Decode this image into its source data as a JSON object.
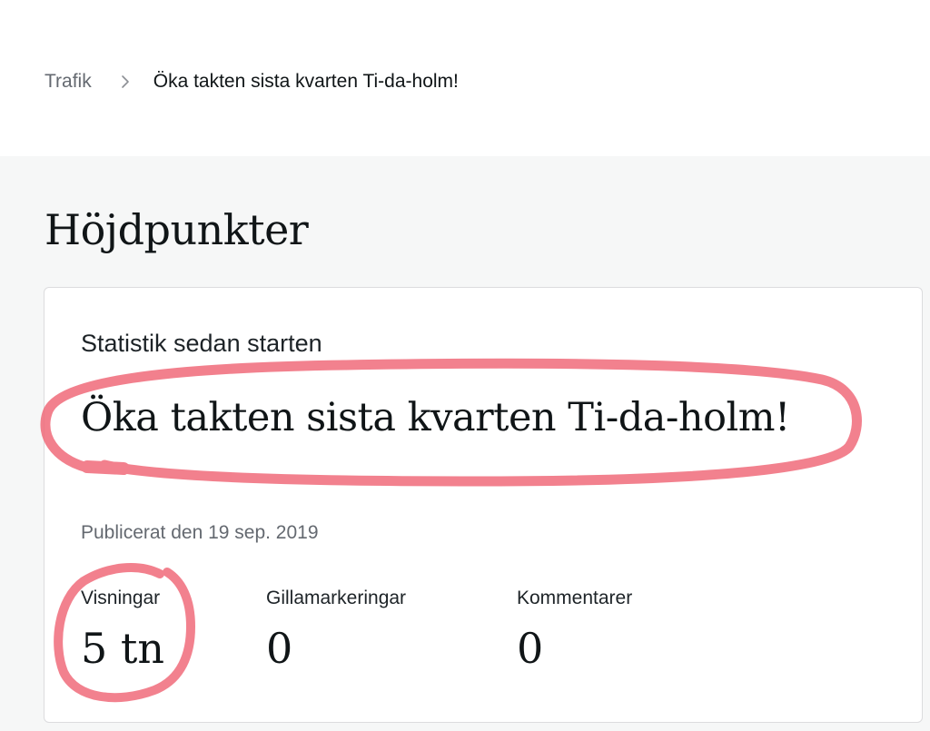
{
  "breadcrumb": {
    "parent": "Trafik",
    "current": "Öka takten sista kvarten Ti-da-holm!"
  },
  "section": {
    "title": "Höjdpunkter"
  },
  "card": {
    "heading": "Statistik sedan starten",
    "post_title": "Öka takten sista kvarten Ti-da-holm!",
    "published": "Publicerat den 19 sep. 2019",
    "stats": [
      {
        "label": "Visningar",
        "value": "5 tn"
      },
      {
        "label": "Gillamarkeringar",
        "value": "0"
      },
      {
        "label": "Kommentarer",
        "value": "0"
      }
    ]
  },
  "colors": {
    "annotation": "#f06b7a",
    "muted_text": "#646970",
    "page_background": "#f6f7f7"
  },
  "icons": {
    "breadcrumb_separator": "chevron-right-icon"
  }
}
